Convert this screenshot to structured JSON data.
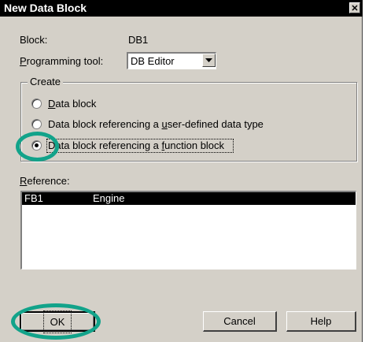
{
  "window": {
    "title": "New Data Block",
    "close_glyph": "✕"
  },
  "fields": {
    "block_label": "Block:",
    "block_value": "DB1",
    "tool_label_u": "P",
    "tool_label_rest": "rogramming tool:",
    "tool_value": "DB Editor"
  },
  "create": {
    "label": "Create",
    "options": [
      {
        "pre": "",
        "u": "D",
        "post": "ata block",
        "selected": false
      },
      {
        "pre": "Data block referencing a ",
        "u": "u",
        "post": "ser-defined data type",
        "selected": false
      },
      {
        "pre": "Data block referencing a ",
        "u": "f",
        "post": "unction block",
        "selected": true
      }
    ]
  },
  "reference": {
    "label_u": "R",
    "label_rest": "eference:",
    "rows": [
      {
        "name": "FB1",
        "description": "Engine",
        "selected": true
      }
    ]
  },
  "buttons": {
    "ok": "OK",
    "cancel": "Cancel",
    "help": "Help"
  },
  "annotations": {
    "highlight_color": "#12a38a"
  }
}
